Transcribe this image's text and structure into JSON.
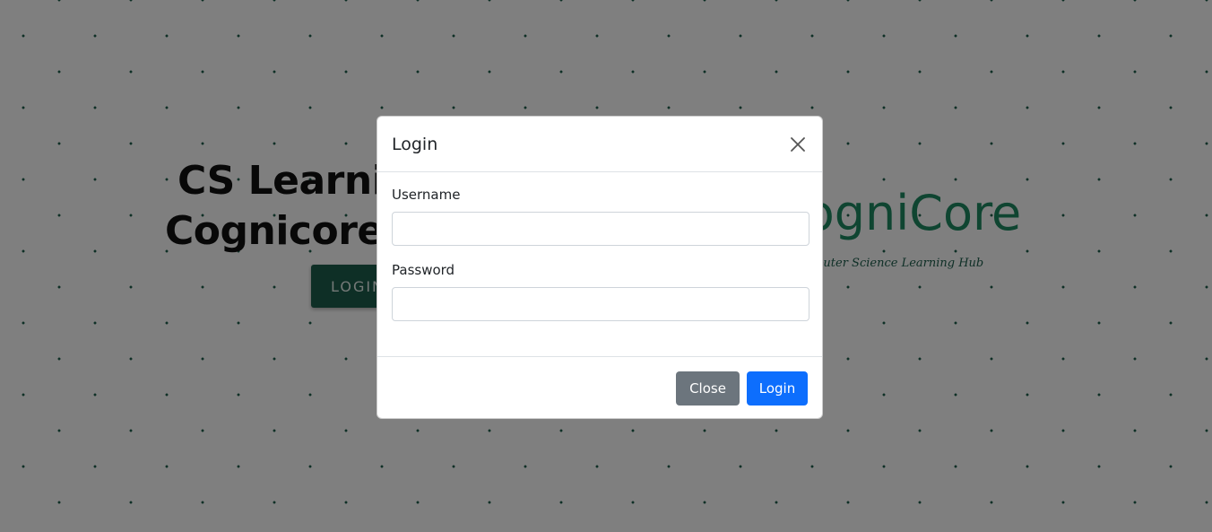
{
  "page": {
    "hero_title_line1": "CS Learning",
    "hero_title_line2": "Cognicore",
    "hero_login_label": "LOGIN",
    "brand_name": "CogniCore",
    "brand_tagline": "Computer Science Learning Hub"
  },
  "modal": {
    "title": "Login",
    "close_icon": "close-icon",
    "username_label": "Username",
    "username_value": "",
    "password_label": "Password",
    "password_value": "",
    "close_button_label": "Close",
    "login_button_label": "Login"
  },
  "colors": {
    "primary": "#0d6efd",
    "secondary": "#6c757d",
    "brand_green": "#1d5e4d",
    "brand_accent": "#1e8a63"
  }
}
